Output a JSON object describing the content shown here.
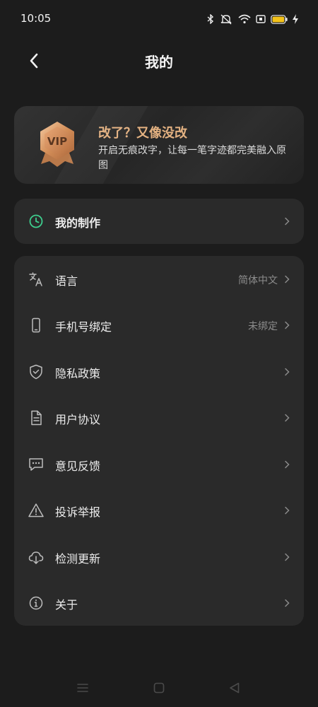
{
  "status_bar": {
    "time": "10:05",
    "icons": [
      "bluetooth-icon",
      "vibrate-off-icon",
      "wifi-icon",
      "sim-card-icon",
      "battery-icon",
      "charging-icon"
    ],
    "battery_color": "#f3c21a"
  },
  "header": {
    "back_icon": "back-arrow-icon",
    "title": "我的"
  },
  "vip_card": {
    "badge_text": "VIP",
    "title": "改了？又像没改",
    "description": "开启无痕改字，让每一笔字迹都完美融入原图",
    "accent_color": "#e3b181"
  },
  "my_creations": {
    "icon": "clock-icon",
    "label": "我的制作",
    "icon_color": "#3ecf8e"
  },
  "settings": [
    {
      "icon": "translate-icon",
      "label": "语言",
      "value": "简体中文"
    },
    {
      "icon": "phone-icon",
      "label": "手机号绑定",
      "value": "未绑定"
    },
    {
      "icon": "shield-check-icon",
      "label": "隐私政策",
      "value": ""
    },
    {
      "icon": "document-icon",
      "label": "用户协议",
      "value": ""
    },
    {
      "icon": "feedback-icon",
      "label": "意见反馈",
      "value": ""
    },
    {
      "icon": "warning-icon",
      "label": "投诉举报",
      "value": ""
    },
    {
      "icon": "cloud-download-icon",
      "label": "检测更新",
      "value": ""
    },
    {
      "icon": "info-icon",
      "label": "关于",
      "value": ""
    }
  ],
  "nav_bar": {
    "buttons": [
      "menu-icon",
      "home-square-icon",
      "back-triangle-icon"
    ]
  }
}
